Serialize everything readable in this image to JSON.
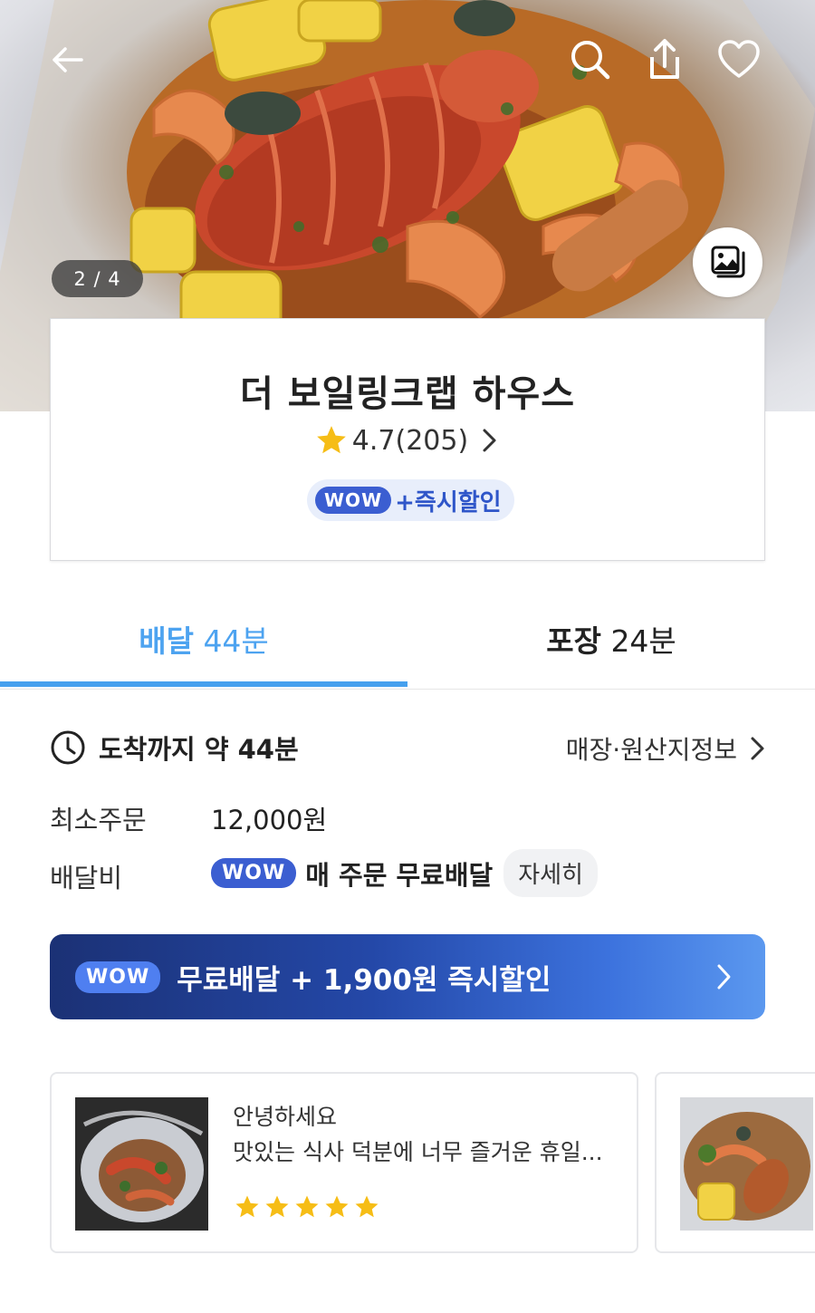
{
  "hero": {
    "image_counter": "2 / 4",
    "icons": [
      "back-arrow-icon",
      "search-icon",
      "share-icon",
      "heart-icon",
      "gallery-icon"
    ]
  },
  "store": {
    "name": "더 보일링크랩 하우스",
    "rating": "4.7",
    "review_count": "(205)",
    "wow_badge": "WOW",
    "promo_label": "+즉시할인"
  },
  "tabs": [
    {
      "label": "배달",
      "time": "44분",
      "active": true
    },
    {
      "label": "포장",
      "time": "24분",
      "active": false
    }
  ],
  "details": {
    "arrival_label": "도착까지 약 44분",
    "store_info_link": "매장·원산지정보",
    "min_order_label": "최소주문",
    "min_order_value": "12,000원",
    "delivery_fee_label": "배달비",
    "delivery_wow_badge": "WOW",
    "delivery_fee_value": "매 주문 무료배달",
    "detail_button": "자세히"
  },
  "banner": {
    "wow_badge": "WOW",
    "text": "무료배달 + 1,900원 즉시할인"
  },
  "reviews": [
    {
      "line1": "안녕하세요",
      "line2": "맛있는 식사 덕분에 너무 즐거운 휴일...",
      "stars": 5
    }
  ],
  "colors": {
    "accent_blue": "#46a0ee",
    "wow_blue": "#3b5ed1",
    "star_yellow": "#f6bd16"
  }
}
